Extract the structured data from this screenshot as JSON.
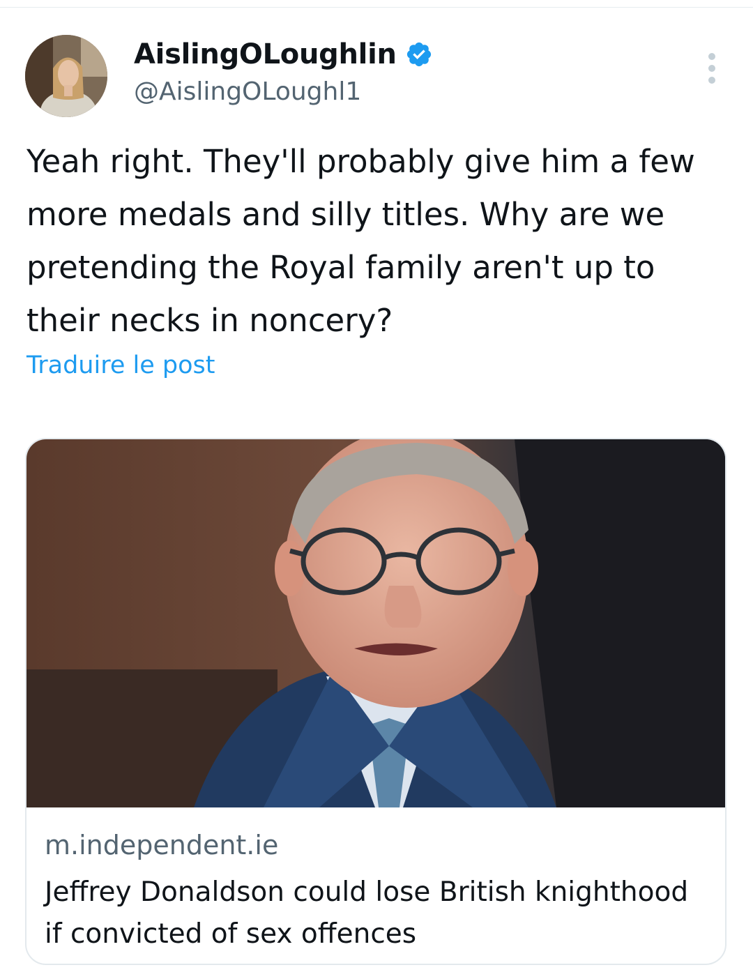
{
  "tweet": {
    "display_name": "AislingOLoughlin",
    "handle": "@AislingOLoughl1",
    "verified": true,
    "text": "Yeah right. They'll probably give him a few more medals and silly titles. Why are we pretending the Royal family aren't up to their necks in noncery?",
    "translate_label": "Traduire le post",
    "more_icon": "more-options-icon"
  },
  "link_card": {
    "source": "m.independent.ie",
    "title": "Jeffrey Donaldson could lose British knighthood if convicted of sex offences"
  },
  "colors": {
    "accent": "#1d9bf0",
    "text_primary": "#0f1419",
    "text_secondary": "#536471",
    "border": "#e3e9ed"
  }
}
